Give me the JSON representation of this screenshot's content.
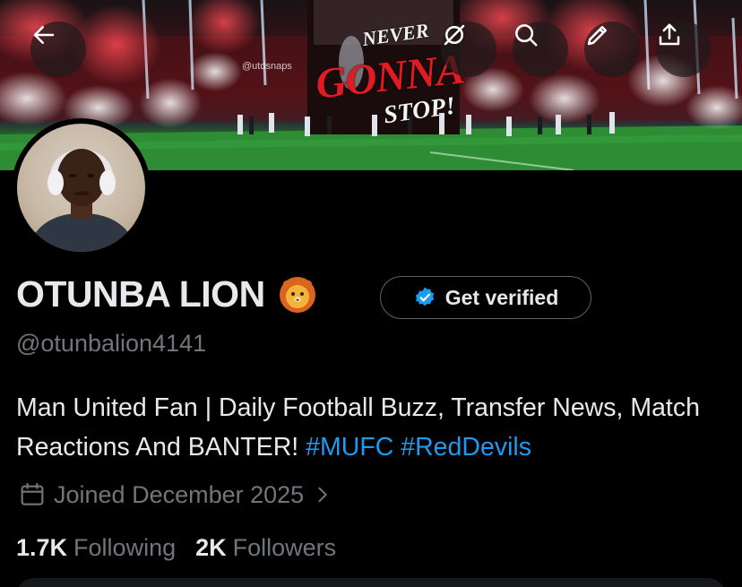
{
  "banner": {
    "watermark": "@utdsnaps",
    "text_top": "NEVER",
    "text_main": "GONNA",
    "text_bottom": "STOP!"
  },
  "header_actions": [
    {
      "name": "back",
      "icon": "arrow-left-icon"
    },
    {
      "name": "grok",
      "icon": "grok-icon"
    },
    {
      "name": "search",
      "icon": "search-icon"
    },
    {
      "name": "edit",
      "icon": "pencil-icon"
    },
    {
      "name": "share",
      "icon": "share-icon"
    }
  ],
  "profile": {
    "display_name": "OTUNBA LION",
    "emoji": "🦁",
    "handle": "@otunbalion4141",
    "bio_text": "Man United Fan | Daily Football Buzz, Transfer News, Match Reactions And BANTER! ",
    "hashtags": [
      "#MUFC",
      "#RedDevils"
    ],
    "joined": "Joined December 2025"
  },
  "verify_button": {
    "label": "Get verified"
  },
  "stats": {
    "following_count": "1.7K",
    "following_label": "Following",
    "followers_count": "2K",
    "followers_label": "Followers"
  },
  "colors": {
    "accent": "#1d9bf0",
    "muted": "#71767b",
    "text": "#e7e9ea",
    "border": "#536471"
  }
}
